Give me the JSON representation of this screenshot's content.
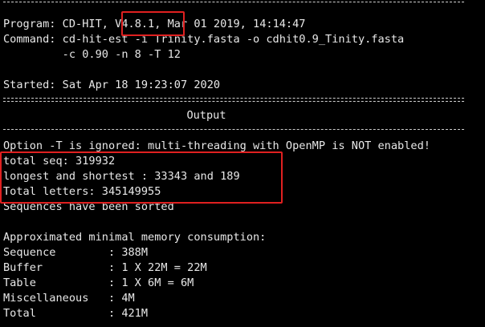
{
  "window": {
    "background": "#000000",
    "text_color": "#e8e8e8",
    "highlight_color": "#e02020"
  },
  "terminal": {
    "program_prefix": "Program: CD-HIT, ",
    "program_version": "V4.8.1,",
    "program_suffix": " Mar 01 2019, 14:14:47",
    "command_line1": "Command: cd-hit-est -i Trinity.fasta -o cdhit0.9_Tinity.fasta",
    "command_line2": "         -c 0.90 -n 8 -T 12",
    "started": "Started: Sat Apr 18 19:23:07 2020",
    "output_heading": "Output",
    "openmp_warning": "Option -T is ignored: multi-threading with OpenMP is NOT enabled!",
    "total_seq": "total seq: 319932",
    "longest_shortest": "longest and shortest : 33343 and 189",
    "total_letters": "Total letters: 345149955",
    "sorted": "Sequences have been sorted",
    "memory_heading": "Approximated minimal memory consumption:",
    "memory_rows": [
      "Sequence        : 388M",
      "Buffer          : 1 X 22M = 22M",
      "Table           : 1 X 6M = 6M",
      "Miscellaneous   : 4M",
      "Total           : 421M"
    ]
  }
}
